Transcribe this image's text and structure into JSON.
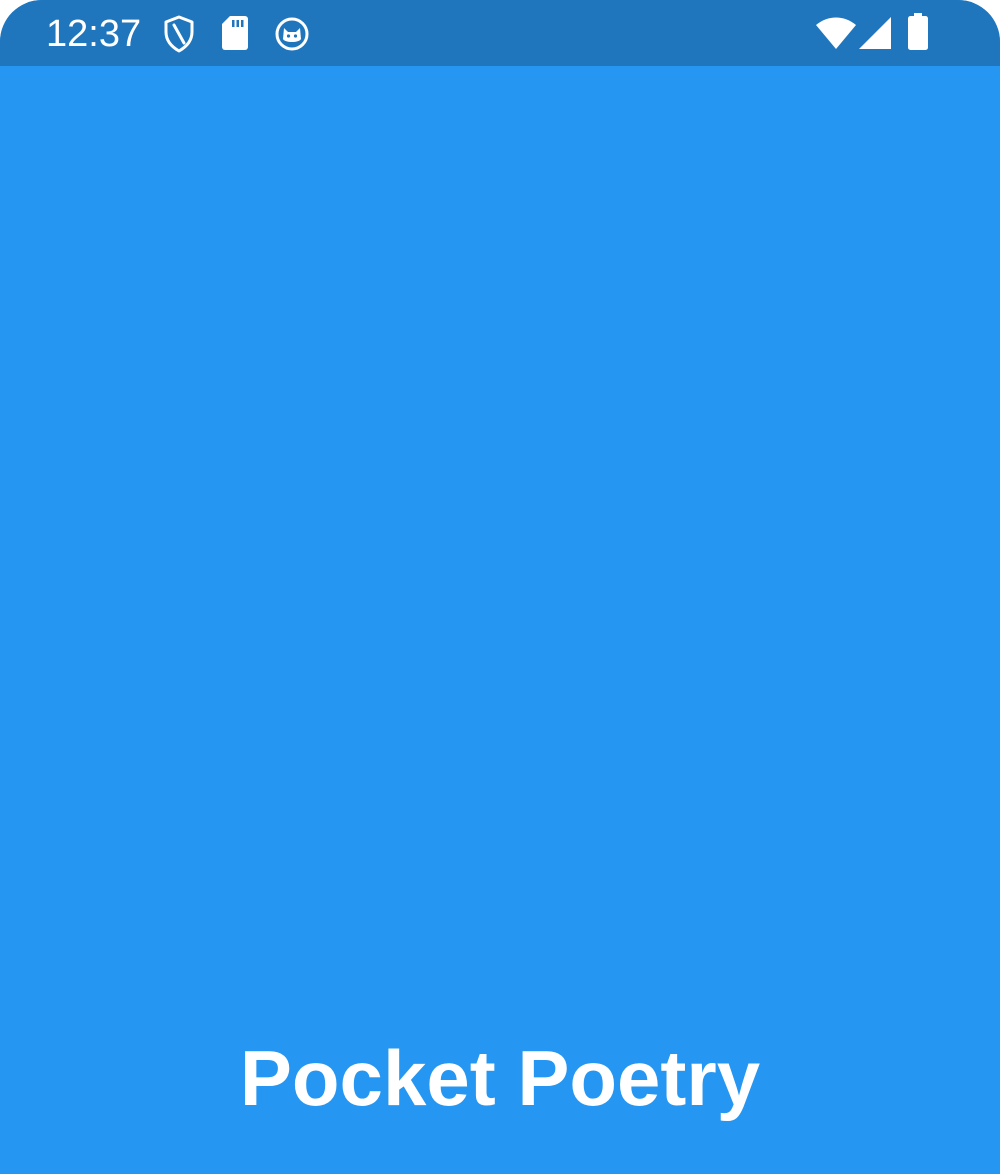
{
  "status_bar": {
    "time": "12:37",
    "left_icons": [
      "shield-icon",
      "sd-card-icon",
      "cat-icon"
    ],
    "right_icons": [
      "wifi-icon",
      "cell-signal-icon",
      "battery-icon"
    ]
  },
  "splash": {
    "title": "Pocket Poetry"
  },
  "colors": {
    "status_bar_background": "#1f76bd",
    "screen_background": "#2596f1",
    "foreground": "#ffffff"
  }
}
